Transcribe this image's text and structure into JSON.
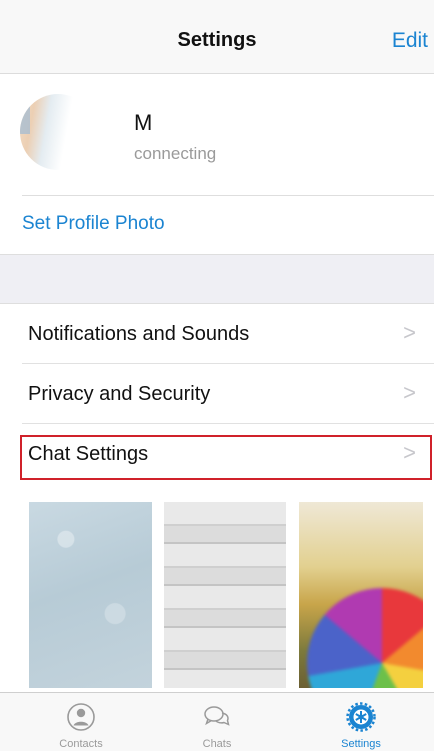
{
  "header": {
    "title": "Settings",
    "edit_label": "Edit"
  },
  "profile": {
    "name": "M",
    "status": "connecting"
  },
  "set_profile_photo": {
    "label": "Set Profile Photo"
  },
  "menu": {
    "items": [
      {
        "label": "Notifications and Sounds",
        "chevron": ">"
      },
      {
        "label": "Privacy and Security",
        "chevron": ">"
      },
      {
        "label": "Chat Settings",
        "chevron": ">",
        "highlighted": true
      }
    ]
  },
  "tabbar": {
    "tabs": [
      {
        "label": "Contacts",
        "icon": "contacts-icon",
        "active": false
      },
      {
        "label": "Chats",
        "icon": "chats-icon",
        "active": false
      },
      {
        "label": "Settings",
        "icon": "settings-gear-icon",
        "active": true
      }
    ]
  },
  "colors": {
    "accent": "#1b84d1",
    "highlight_box": "#d0212a",
    "secondary_text": "#9a9a9a"
  }
}
